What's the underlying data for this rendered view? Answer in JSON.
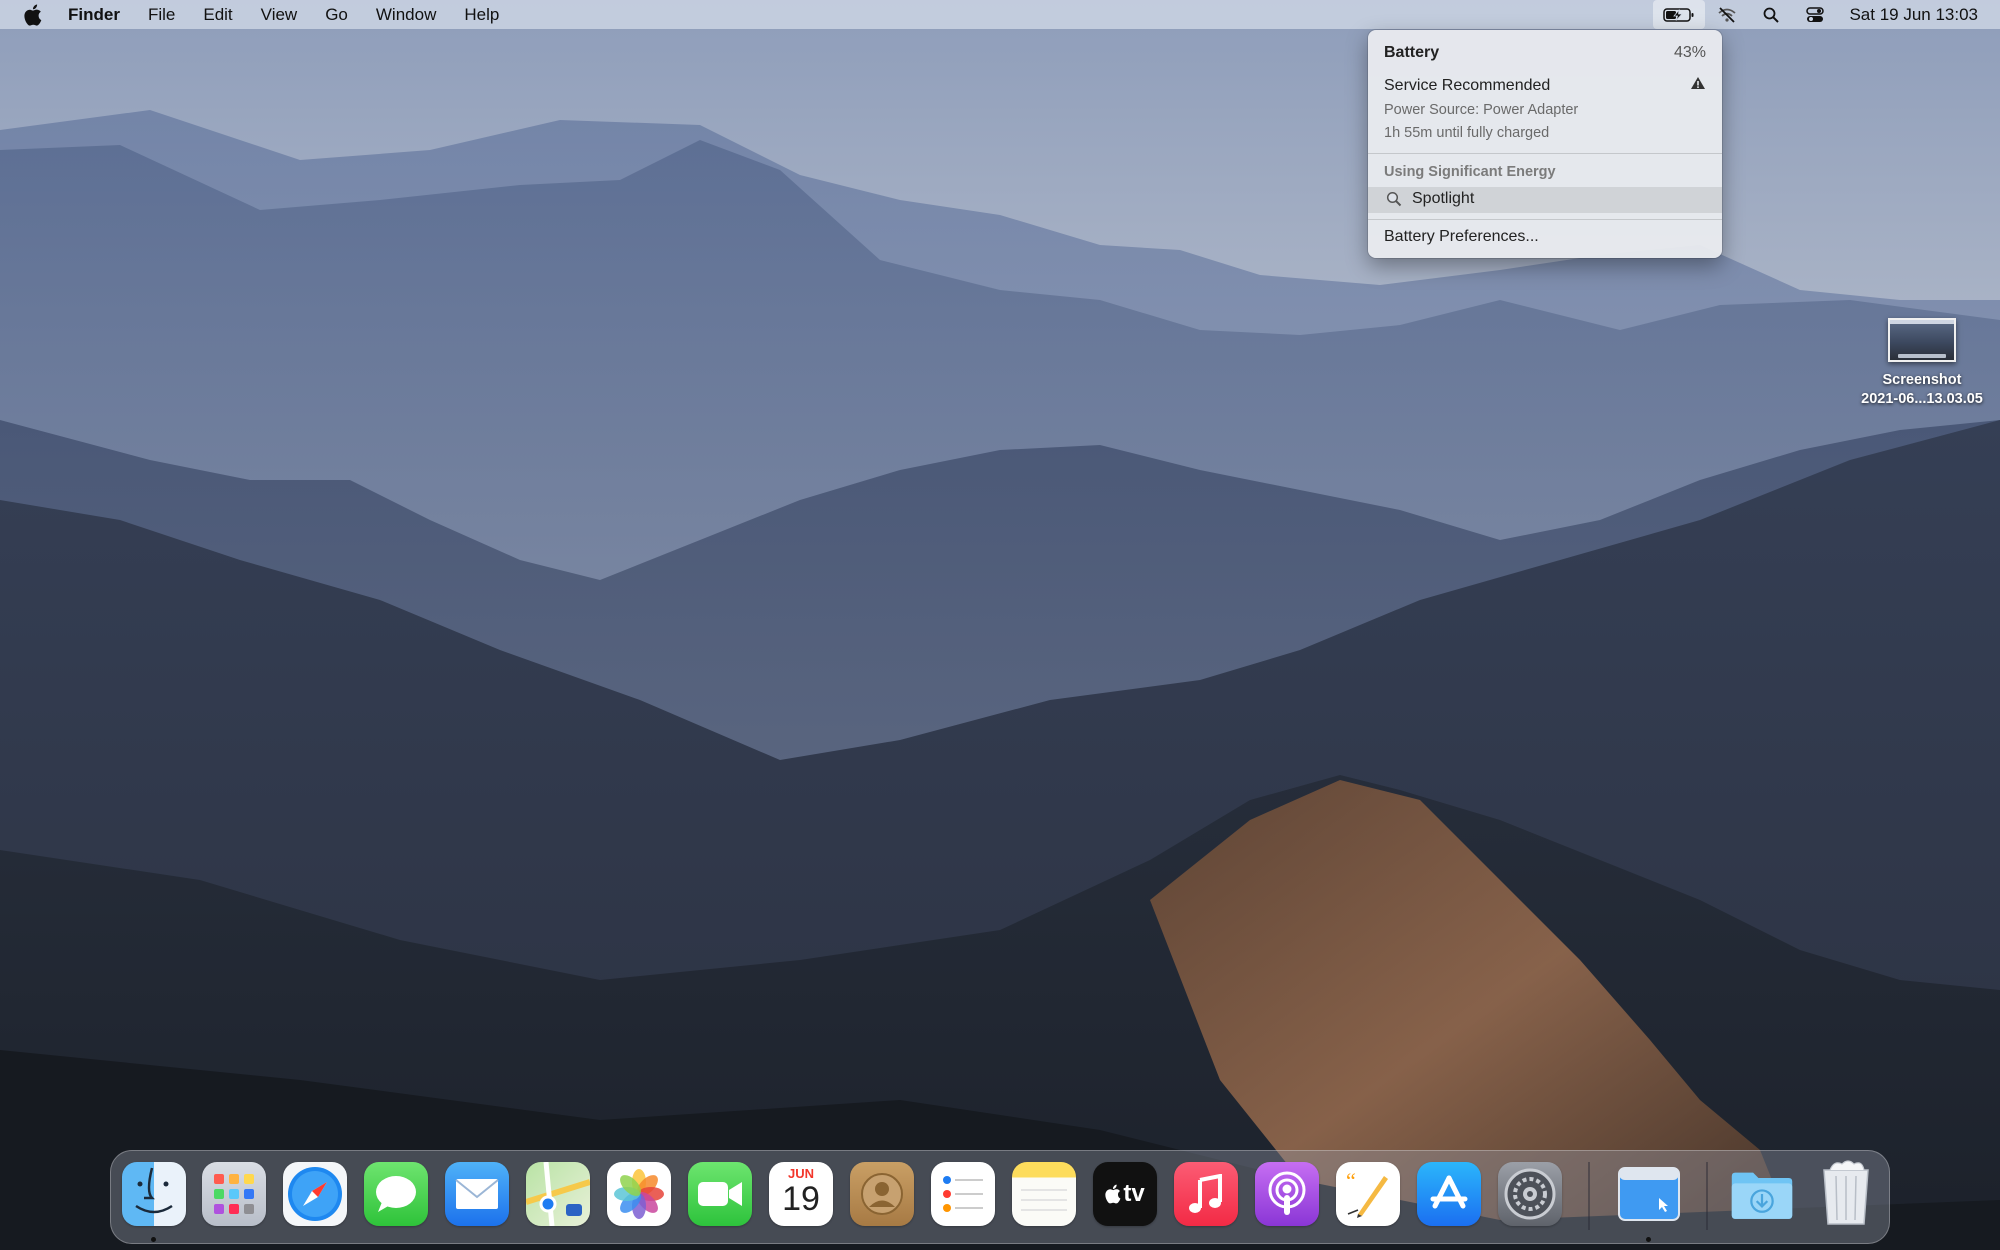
{
  "menubar": {
    "apple_icon": "apple-logo-icon",
    "app_name": "Finder",
    "menus": [
      "File",
      "Edit",
      "View",
      "Go",
      "Window",
      "Help"
    ],
    "status_icons": [
      "battery-charging-icon",
      "wifi-off-icon",
      "spotlight-search-icon",
      "control-center-icon"
    ],
    "clock": "Sat 19 Jun  13:03"
  },
  "battery_menu": {
    "title": "Battery",
    "percent": "43%",
    "service_label": "Service Recommended",
    "power_source": "Power Source: Power Adapter",
    "time_remaining": "1h 55m until fully charged",
    "energy_header": "Using Significant Energy",
    "energy_app": "Spotlight",
    "preferences": "Battery Preferences..."
  },
  "desktop": {
    "file_name_line1": "Screenshot",
    "file_name_line2": "2021-06...13.03.05"
  },
  "dock": {
    "apps": [
      "Finder",
      "Launchpad",
      "Safari",
      "Messages",
      "Mail",
      "Maps",
      "Photos",
      "FaceTime",
      "Calendar",
      "Contacts",
      "Reminders",
      "Notes",
      "TV",
      "Music",
      "Podcasts",
      "Pages",
      "App Store",
      "System Preferences",
      "Screenshot",
      "Downloads",
      "Trash"
    ],
    "calendar_month": "JUN",
    "calendar_day": "19",
    "tv_label": "tv"
  },
  "colors": {
    "menubar_bg": "#cdd6e4",
    "menu_bg": "#e8eaee",
    "accent_blue": "#1e7cf2"
  }
}
